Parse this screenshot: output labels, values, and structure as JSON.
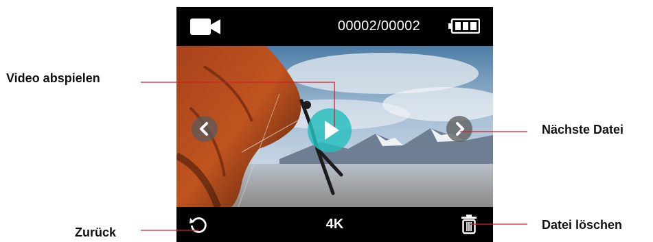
{
  "screen": {
    "mode_icon": "video-camera-icon",
    "file_counter": "00002/00002",
    "battery_icon": "battery-full-icon",
    "resolution": "4K",
    "controls": {
      "play_icon": "play-icon",
      "prev_icon": "chevron-left-icon",
      "next_icon": "chevron-right-icon",
      "back_icon": "back-arrow-icon",
      "delete_icon": "trash-icon"
    }
  },
  "callouts": {
    "play": "Video abspielen",
    "next": "Nächste Datei",
    "back": "Zurück",
    "delete": "Datei löschen"
  },
  "colors": {
    "leader_line": "#d21f2a",
    "play_button": "#26bebe"
  }
}
